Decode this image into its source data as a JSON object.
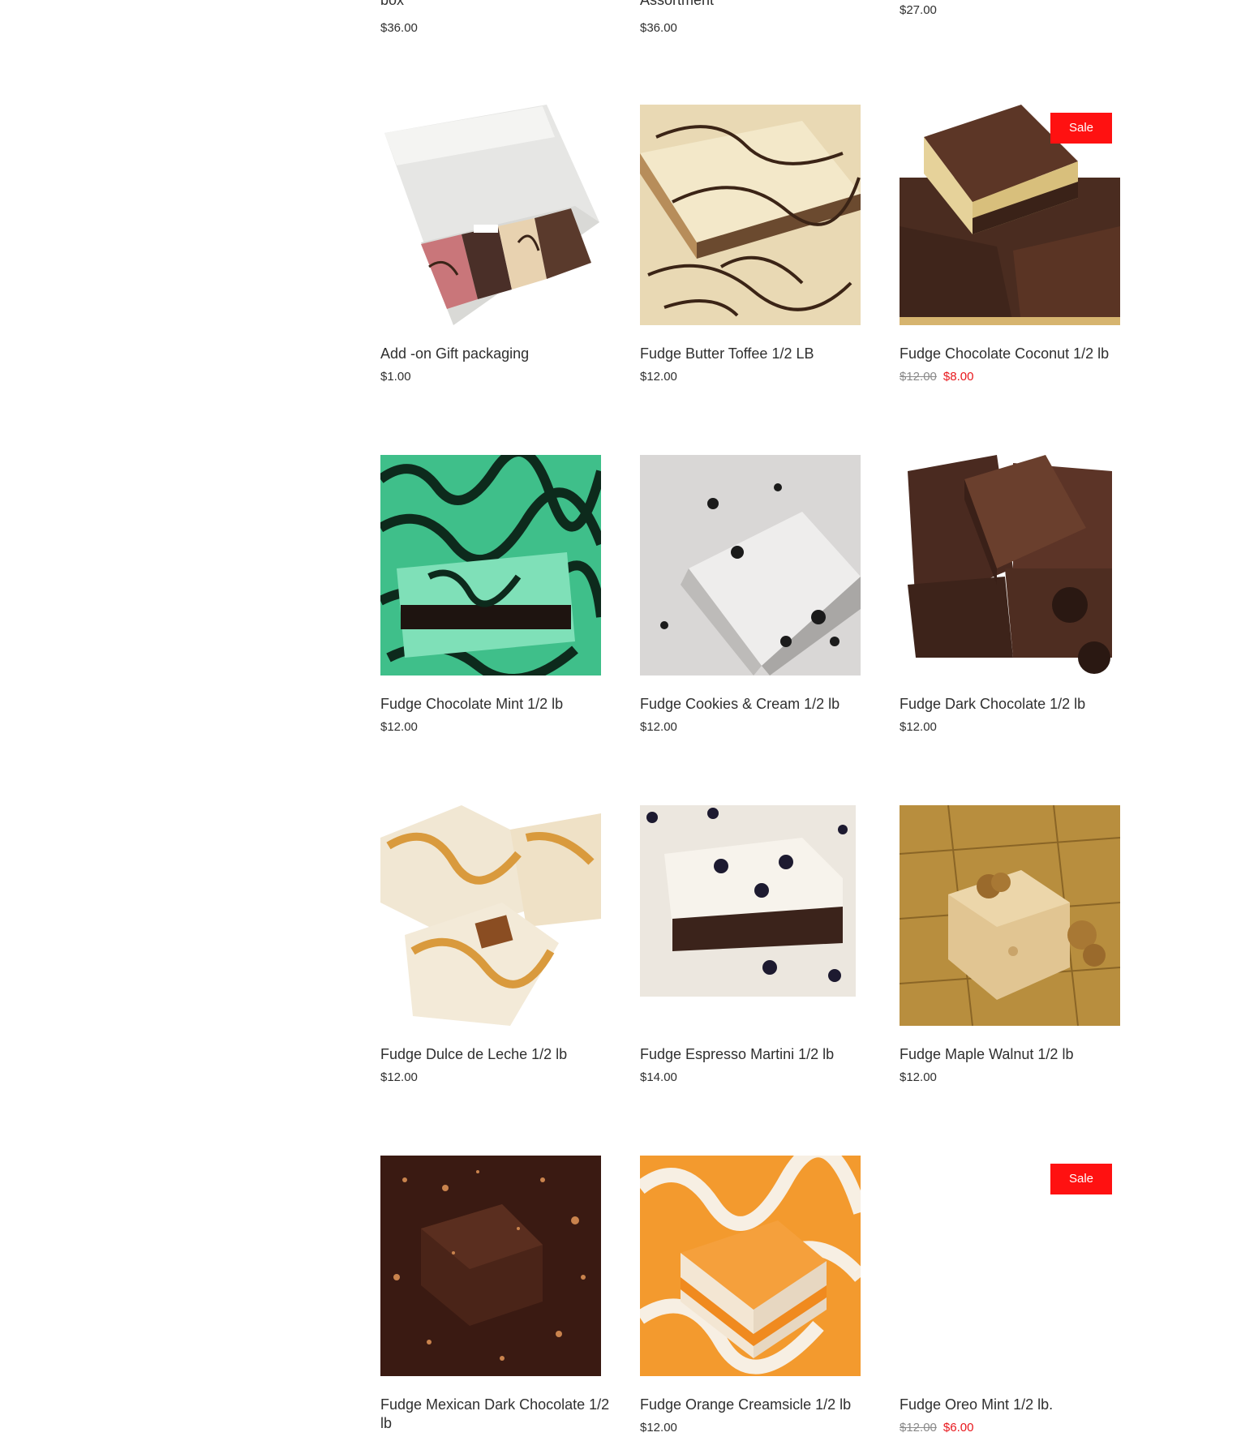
{
  "top_row": [
    {
      "name_tail": "box",
      "price": "$36.00"
    },
    {
      "name_tail": "Assortment",
      "price": "$36.00"
    },
    {
      "name_tail": "",
      "price": "$27.00"
    }
  ],
  "products": [
    {
      "name": "Add -on Gift packaging",
      "price": "$1.00",
      "image": "gift-box-image"
    },
    {
      "name": "Fudge Butter Toffee 1/2 LB",
      "price": "$12.00",
      "image": "butter-toffee-image"
    },
    {
      "name": "Fudge Chocolate Coconut 1/2 lb",
      "original_price": "$12.00",
      "sale_price": "$8.00",
      "badge": "Sale",
      "image": "chocolate-coconut-image"
    },
    {
      "name": "Fudge Chocolate Mint 1/2 lb",
      "price": "$12.00",
      "image": "chocolate-mint-image"
    },
    {
      "name": "Fudge Cookies & Cream 1/2 lb",
      "price": "$12.00",
      "image": "cookies-cream-image"
    },
    {
      "name": "Fudge Dark Chocolate 1/2 lb",
      "price": "$12.00",
      "image": "dark-chocolate-image"
    },
    {
      "name": "Fudge Dulce de Leche 1/2 lb",
      "price": "$12.00",
      "image": "dulce-de-leche-image"
    },
    {
      "name": "Fudge Espresso Martini 1/2 lb",
      "price": "$14.00",
      "image": "espresso-martini-image"
    },
    {
      "name": "Fudge Maple Walnut 1/2 lb",
      "price": "$12.00",
      "image": "maple-walnut-image"
    },
    {
      "name": "Fudge Mexican Dark Chocolate 1/2 lb",
      "price": "",
      "image": "mexican-dark-chocolate-image"
    },
    {
      "name": "Fudge Orange Creamsicle 1/2 lb",
      "price": "$12.00",
      "image": "orange-creamsicle-image"
    },
    {
      "name": "Fudge Oreo Mint 1/2 lb.",
      "original_price": "$12.00",
      "sale_price": "$6.00",
      "badge": "Sale",
      "image": "oreo-mint-image"
    }
  ]
}
